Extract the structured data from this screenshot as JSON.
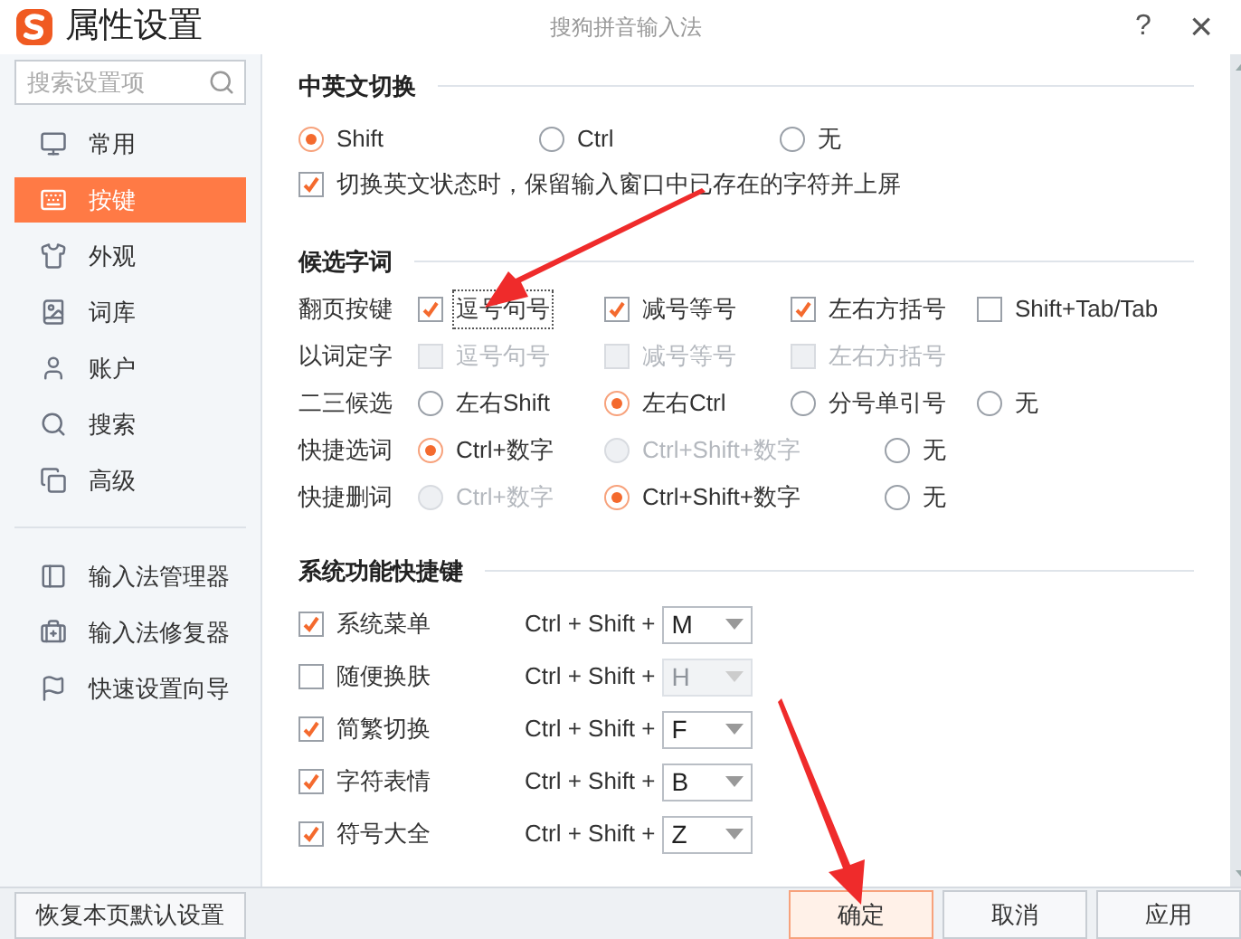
{
  "window": {
    "title": "属性设置",
    "app_name": "搜狗拼音输入法",
    "help": "?",
    "close": "×"
  },
  "sidebar": {
    "search": {
      "placeholder": "搜索设置项"
    },
    "items": [
      {
        "label": "常用",
        "selected": false
      },
      {
        "label": "按键",
        "selected": true
      },
      {
        "label": "外观",
        "selected": false
      },
      {
        "label": "词库",
        "selected": false
      },
      {
        "label": "账户",
        "selected": false
      },
      {
        "label": "搜索",
        "selected": false
      },
      {
        "label": "高级",
        "selected": false
      }
    ],
    "tools": [
      {
        "label": "输入法管理器"
      },
      {
        "label": "输入法修复器"
      },
      {
        "label": "快速设置向导"
      }
    ]
  },
  "sections": [
    {
      "title": "中英文切换",
      "rows": [
        {
          "options": [
            {
              "kind": "radio",
              "label": "Shift",
              "selected": true,
              "disabled": false
            },
            {
              "kind": "radio",
              "label": "Ctrl",
              "selected": false,
              "disabled": false
            },
            {
              "kind": "radio",
              "label": "无",
              "selected": false,
              "disabled": false
            }
          ]
        },
        {
          "options": [
            {
              "kind": "checkbox",
              "label": "切换英文状态时，保留输入窗口中已存在的字符并上屏",
              "checked": true,
              "disabled": false
            }
          ]
        }
      ]
    },
    {
      "title": "候选字词",
      "rows": [
        {
          "label": "翻页按键",
          "options": [
            {
              "kind": "checkbox",
              "label": "逗号句号",
              "checked": true,
              "disabled": false,
              "focused": true
            },
            {
              "kind": "checkbox",
              "label": "减号等号",
              "checked": true,
              "disabled": false
            },
            {
              "kind": "checkbox",
              "label": "左右方括号",
              "checked": true,
              "disabled": false
            },
            {
              "kind": "checkbox",
              "label": "Shift+Tab/Tab",
              "checked": false,
              "disabled": false
            }
          ]
        },
        {
          "label": "以词定字",
          "options": [
            {
              "kind": "checkbox",
              "label": "逗号句号",
              "checked": false,
              "disabled": true
            },
            {
              "kind": "checkbox",
              "label": "减号等号",
              "checked": false,
              "disabled": true
            },
            {
              "kind": "checkbox",
              "label": "左右方括号",
              "checked": false,
              "disabled": true
            }
          ]
        },
        {
          "label": "二三候选",
          "options": [
            {
              "kind": "radio",
              "label": "左右Shift",
              "selected": false,
              "disabled": false
            },
            {
              "kind": "radio",
              "label": "左右Ctrl",
              "selected": true,
              "disabled": false
            },
            {
              "kind": "radio",
              "label": "分号单引号",
              "selected": false,
              "disabled": false
            },
            {
              "kind": "radio",
              "label": "无",
              "selected": false,
              "disabled": false
            }
          ]
        },
        {
          "label": "快捷选词",
          "options": [
            {
              "kind": "radio",
              "label": "Ctrl+数字",
              "selected": true,
              "disabled": false
            },
            {
              "kind": "radio",
              "label": "Ctrl+Shift+数字",
              "selected": false,
              "disabled": true
            },
            {
              "kind": "radio",
              "label": "无",
              "selected": false,
              "disabled": false
            }
          ]
        },
        {
          "label": "快捷删词",
          "options": [
            {
              "kind": "radio",
              "label": "Ctrl+数字",
              "selected": false,
              "disabled": true
            },
            {
              "kind": "radio",
              "label": "Ctrl+Shift+数字",
              "selected": true,
              "disabled": false
            },
            {
              "kind": "radio",
              "label": "无",
              "selected": false,
              "disabled": false
            }
          ]
        }
      ]
    },
    {
      "title": "系统功能快捷键",
      "shortcuts": [
        {
          "label": "系统菜单",
          "checked": true,
          "prefix": "Ctrl + Shift +",
          "key": "M"
        },
        {
          "label": "随便换肤",
          "checked": false,
          "prefix": "Ctrl + Shift +",
          "key": "H"
        },
        {
          "label": "简繁切换",
          "checked": true,
          "prefix": "Ctrl + Shift +",
          "key": "F"
        },
        {
          "label": "字符表情",
          "checked": true,
          "prefix": "Ctrl + Shift +",
          "key": "B"
        },
        {
          "label": "符号大全",
          "checked": true,
          "prefix": "Ctrl + Shift +",
          "key": "Z"
        }
      ]
    }
  ],
  "footer": {
    "reset": "恢复本页默认设置",
    "buttons": [
      {
        "label": "确定",
        "primary": true
      },
      {
        "label": "取消",
        "primary": false
      },
      {
        "label": "应用",
        "primary": false
      }
    ]
  }
}
